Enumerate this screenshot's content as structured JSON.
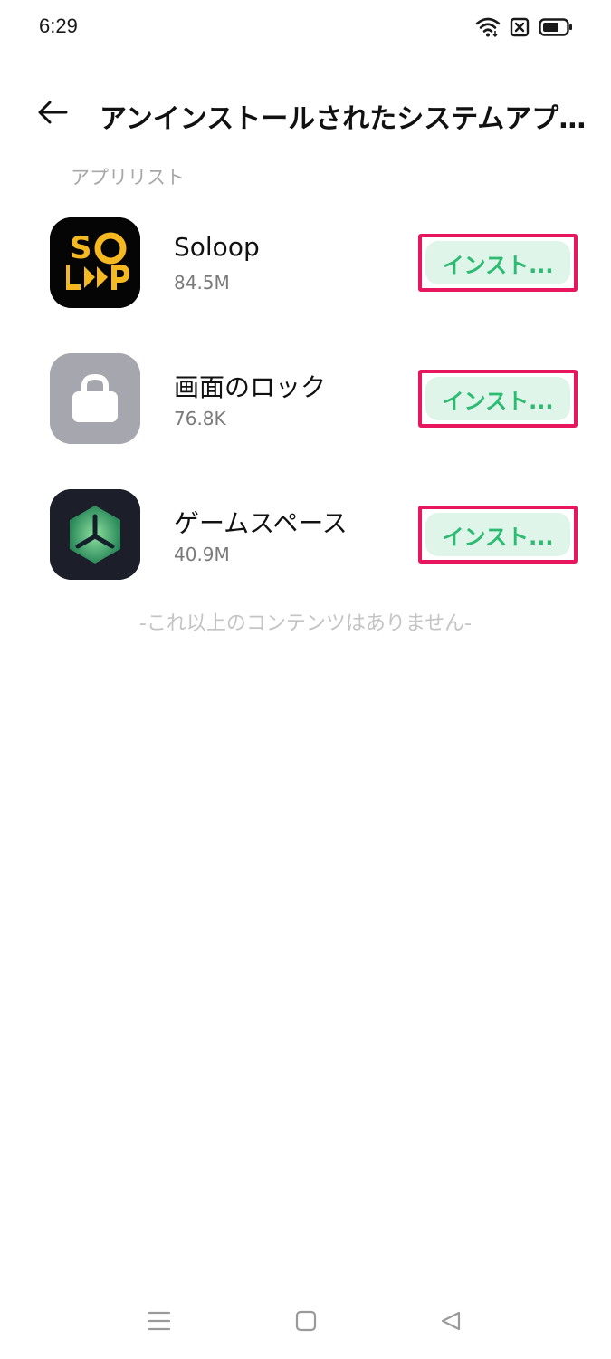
{
  "status_bar": {
    "time": "6:29",
    "icons": [
      "wifi-icon",
      "sim-blocked-icon",
      "battery-icon"
    ]
  },
  "header": {
    "back_icon": "arrow-left-icon",
    "title": "アンインストールされたシステムアプ..."
  },
  "section": {
    "label": "アプリリスト"
  },
  "apps": [
    {
      "name": "Soloop",
      "size": "84.5M",
      "button_label": "インスト...",
      "icon": "soloop-icon"
    },
    {
      "name": "画面のロック",
      "size": "76.8K",
      "button_label": "インスト...",
      "icon": "lock-icon"
    },
    {
      "name": "ゲームスペース",
      "size": "40.9M",
      "button_label": "インスト...",
      "icon": "game-space-icon"
    }
  ],
  "end_note": "-これ以上のコンテンツはありません-",
  "nav_bar": {
    "icons": [
      "menu-icon",
      "home-icon",
      "back-triangle-icon"
    ]
  },
  "colors": {
    "accent_green": "#2dbb72",
    "button_bg": "#dff5ea",
    "highlight_border": "#e8175d"
  }
}
